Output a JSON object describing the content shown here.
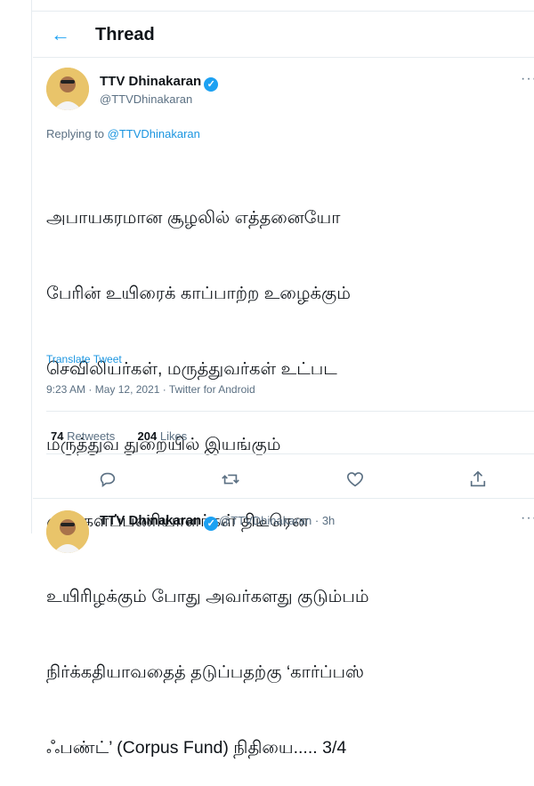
{
  "header": {
    "title": "Thread"
  },
  "tweet": {
    "author_name": "TTV Dhinakaran",
    "author_handle": "@TTVDhinakaran",
    "replying_prefix": "Replying to ",
    "replying_handle": "@TTVDhinakaran",
    "text_lines": [
      "அபாயகரமான சூழலில் எத்தனையோ",
      "பேரின் உயிரைக் காப்பாற்ற உழைக்கும்",
      "செவிலியர்கள், மருத்துவர்கள் உட்பட",
      "மருத்துவ துறையில் இயங்கும்",
      "முன்களப்பணியாளர்கள் திடீரென",
      "உயிரிழக்கும் போது அவர்களது குடும்பம்",
      "நிர்க்கதியாவதைத் தடுப்பதற்கு ‘கார்ப்பஸ்",
      "ஃபண்ட்’ (Corpus Fund) நிதியை..... 3/4"
    ],
    "translate_label": "Translate Tweet",
    "time": "9:23 AM",
    "date": "May 12, 2021",
    "source": "Twitter for Android",
    "retweets_count": "74",
    "retweets_label": "Retweets",
    "likes_count": "204",
    "likes_label": "Likes"
  },
  "next_tweet": {
    "author_name": "TTV Dhinakaran",
    "author_handle": "@TTVDhinakaran",
    "age": "3h"
  },
  "icons": {
    "back": "back-arrow-icon",
    "verified": "verified-badge-icon",
    "more": "more-options-icon",
    "reply": "reply-icon",
    "retweet": "retweet-icon",
    "like": "heart-icon",
    "share": "share-icon"
  },
  "colors": {
    "accent": "#1da1f2",
    "link": "#1b95e0",
    "muted": "#5b7083",
    "text": "#0f1419"
  }
}
